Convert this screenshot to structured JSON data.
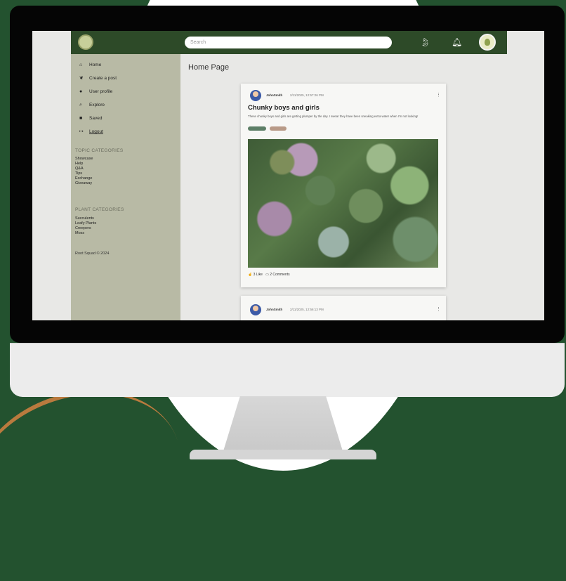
{
  "app": {
    "search_placeholder": "Search",
    "page_title": "Home Page",
    "colors": {
      "header": "#2d4a28",
      "sidebar": "#b8baa5",
      "page_bg": "#23522f"
    }
  },
  "header_icons": [
    "leaf-icon",
    "bell-icon",
    "avatar"
  ],
  "sidebar": {
    "nav": [
      {
        "label": "Home",
        "icon": "home-icon"
      },
      {
        "label": "Create a post",
        "icon": "leaf-icon"
      },
      {
        "label": "User profile",
        "icon": "user-icon"
      },
      {
        "label": "Explore",
        "icon": "search-icon"
      },
      {
        "label": "Saved",
        "icon": "bookmark-icon"
      },
      {
        "label": "Logout",
        "icon": "logout-icon"
      }
    ],
    "topic_heading": "TOPIC CATEGORIES",
    "topics": [
      "Showcase",
      "Help",
      "Q&A",
      "Tips",
      "Exchange",
      "Giveaway"
    ],
    "plant_heading": "PLANT CATEGORIES",
    "plants": [
      "Succulents",
      "Leafy Plants",
      "Creepers",
      "Moss"
    ],
    "footer": "Root Squad © 2024"
  },
  "posts": [
    {
      "author": "JohnSmith",
      "date": "2/11/2025, 12:57:26 PM",
      "title": "Chunky boys and girls",
      "body": "These chunky boys and girls are getting plumper by the day. I swear they have been sneaking extra water when I'm not looking!",
      "tag_colors": [
        "#5c7e66",
        "#b89a87"
      ],
      "likes": "3 Like",
      "comments": "2 Comments"
    },
    {
      "author": "JohnSmith",
      "date": "2/11/2025, 12:56:13 PM"
    }
  ]
}
